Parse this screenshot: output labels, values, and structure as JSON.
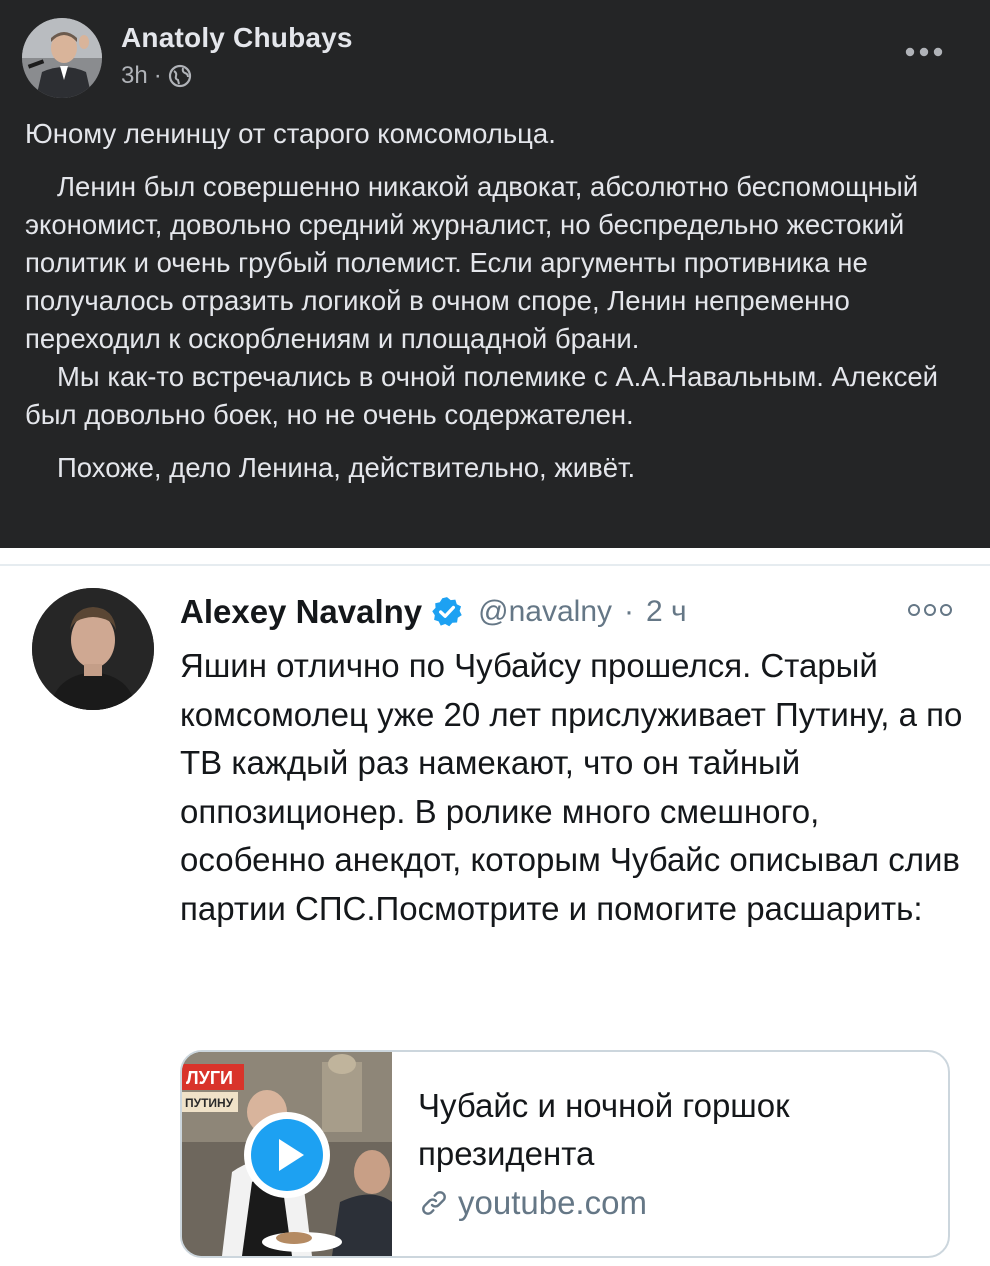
{
  "facebook_post": {
    "author": "Anatoly Chubays",
    "time": "3h",
    "separator": "·",
    "privacy_icon": "globe-icon",
    "paragraphs": [
      "Юному ленинцу от старого комсомольца.",
      "Ленин был совершенно никакой адвокат, абсолютно беспомощный экономист, довольно средний журналист, но беспредельно жестокий политик и очень грубый полемист. Если аргументы противника не получалось отразить логикой в очном споре, Ленин непременно переходил к оскорблениям и площадной брани.",
      "Мы как-то встречались в очной полемике с А.А.Навальным. Алексей был довольно боек, но не очень содержателен.",
      "Похоже, дело Ленина, действительно, живёт."
    ],
    "colors": {
      "background": "#242526",
      "text": "#e4e6eb",
      "secondary": "#b0b3b8"
    }
  },
  "tweet": {
    "name": "Alexey Navalny",
    "verified_icon": "verified-badge-icon",
    "handle": "@navalny",
    "separator": "·",
    "time": "2 ч",
    "text": "Яшин отлично по Чубайсу прошелся. Старый комсомолец уже 20 лет прислуживает Путину, а по ТВ каждый раз намекают, что он тайный оппозиционер. В ролике много смешного, особенно анекдот, которым Чубайс описывал слив партии СПС.Посмотрите и помогите расшарить:",
    "card": {
      "thumbnail_caption_1": "ЛУГИ",
      "thumbnail_caption_2": "ПУТИНУ",
      "play_icon": "play-button-icon",
      "title": "Чубайс и ночной горшок президента",
      "link_icon": "link-icon",
      "domain": "youtube.com"
    },
    "colors": {
      "accent": "#1da1f2",
      "text": "#14171a",
      "secondary": "#657786",
      "border": "#ccd6dd"
    }
  }
}
